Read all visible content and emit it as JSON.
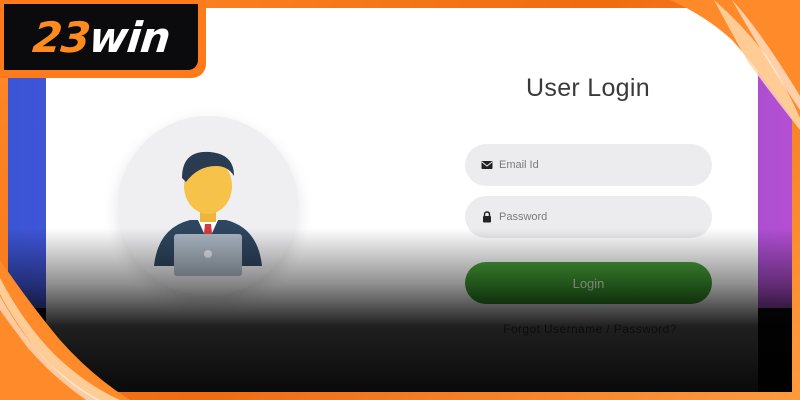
{
  "brand": {
    "logo_number": "23",
    "logo_word": "win",
    "accent_color": "#ff7a1a"
  },
  "login": {
    "title": "User Login",
    "email_placeholder": "Email Id",
    "password_placeholder": "Password",
    "submit_label": "Login",
    "forgot_link": "Forgot Username / Password?",
    "button_color": "#3a9a30"
  },
  "icons": {
    "email": "envelope-icon",
    "password": "lock-icon",
    "avatar": "user-avatar-icon"
  }
}
